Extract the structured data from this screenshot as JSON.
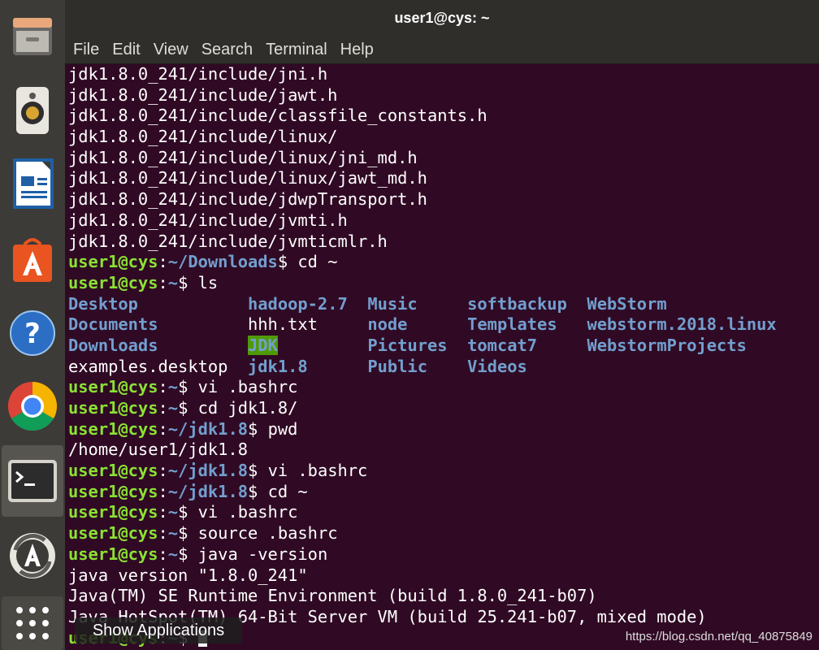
{
  "window": {
    "title": "user1@cys: ~"
  },
  "menu": [
    "File",
    "Edit",
    "View",
    "Search",
    "Terminal",
    "Help"
  ],
  "dock": [
    {
      "name": "files-icon"
    },
    {
      "name": "rhythmbox-icon"
    },
    {
      "name": "libreoffice-writer-icon"
    },
    {
      "name": "ubuntu-software-icon"
    },
    {
      "name": "help-icon"
    },
    {
      "name": "chrome-icon"
    },
    {
      "name": "terminal-icon"
    },
    {
      "name": "software-updater-icon"
    },
    {
      "name": "show-applications-icon"
    }
  ],
  "tooltip": "Show Applications",
  "watermark": "https://blog.csdn.net/qq_40875849",
  "terminal": {
    "prompt_user": "user1@cys",
    "lines": [
      {
        "type": "text",
        "text": "jdk1.8.0_241/include/jni.h"
      },
      {
        "type": "text",
        "text": "jdk1.8.0_241/include/jawt.h"
      },
      {
        "type": "text",
        "text": "jdk1.8.0_241/include/classfile_constants.h"
      },
      {
        "type": "text",
        "text": "jdk1.8.0_241/include/linux/"
      },
      {
        "type": "text",
        "text": "jdk1.8.0_241/include/linux/jni_md.h"
      },
      {
        "type": "text",
        "text": "jdk1.8.0_241/include/linux/jawt_md.h"
      },
      {
        "type": "text",
        "text": "jdk1.8.0_241/include/jdwpTransport.h"
      },
      {
        "type": "text",
        "text": "jdk1.8.0_241/include/jvmti.h"
      },
      {
        "type": "text",
        "text": "jdk1.8.0_241/include/jvmticmlr.h"
      },
      {
        "type": "prompt",
        "path": "~/Downloads",
        "cmd": "cd ~"
      },
      {
        "type": "prompt",
        "path": "~",
        "cmd": "ls"
      },
      {
        "type": "ls",
        "cells": [
          {
            "text": "Desktop",
            "kind": "dir"
          },
          {
            "text": "hadoop-2.7",
            "kind": "dir"
          },
          {
            "text": "Music",
            "kind": "dir"
          },
          {
            "text": "softbackup",
            "kind": "dir"
          },
          {
            "text": "WebStorm",
            "kind": "dir"
          }
        ]
      },
      {
        "type": "ls",
        "cells": [
          {
            "text": "Documents",
            "kind": "dir"
          },
          {
            "text": "hhh.txt",
            "kind": "file"
          },
          {
            "text": "node",
            "kind": "dir"
          },
          {
            "text": "Templates",
            "kind": "dir"
          },
          {
            "text": "webstorm.2018.linux",
            "kind": "dir"
          }
        ]
      },
      {
        "type": "ls",
        "cells": [
          {
            "text": "Downloads",
            "kind": "dir"
          },
          {
            "text": "JDK",
            "kind": "hl"
          },
          {
            "text": "Pictures",
            "kind": "dir"
          },
          {
            "text": "tomcat7",
            "kind": "dir"
          },
          {
            "text": "WebstormProjects",
            "kind": "dir"
          }
        ]
      },
      {
        "type": "ls",
        "cells": [
          {
            "text": "examples.desktop",
            "kind": "file"
          },
          {
            "text": "jdk1.8",
            "kind": "dir"
          },
          {
            "text": "Public",
            "kind": "dir"
          },
          {
            "text": "Videos",
            "kind": "dir"
          }
        ]
      },
      {
        "type": "prompt",
        "path": "~",
        "cmd": "vi .bashrc"
      },
      {
        "type": "prompt",
        "path": "~",
        "cmd": "cd jdk1.8/"
      },
      {
        "type": "prompt",
        "path": "~/jdk1.8",
        "cmd": "pwd"
      },
      {
        "type": "text",
        "text": "/home/user1/jdk1.8"
      },
      {
        "type": "prompt",
        "path": "~/jdk1.8",
        "cmd": "vi .bashrc"
      },
      {
        "type": "prompt",
        "path": "~/jdk1.8",
        "cmd": "cd ~"
      },
      {
        "type": "prompt",
        "path": "~",
        "cmd": "vi .bashrc"
      },
      {
        "type": "prompt",
        "path": "~",
        "cmd": "source .bashrc"
      },
      {
        "type": "prompt",
        "path": "~",
        "cmd": "java -version"
      },
      {
        "type": "text",
        "text": "java version \"1.8.0_241\""
      },
      {
        "type": "text",
        "text": "Java(TM) SE Runtime Environment (build 1.8.0_241-b07)"
      },
      {
        "type": "text",
        "text": "Java HotSpot(TM) 64-Bit Server VM (build 25.241-b07, mixed mode)"
      },
      {
        "type": "prompt",
        "path": "~",
        "cmd": "",
        "cursor": true
      }
    ]
  }
}
